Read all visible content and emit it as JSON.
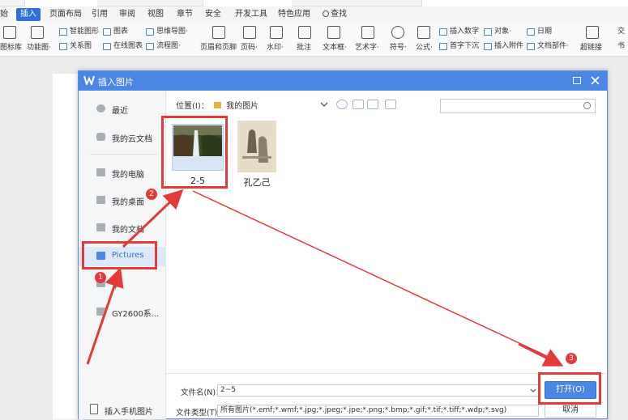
{
  "menu": {
    "tabs": [
      "始",
      "插入",
      "页面布局",
      "引用",
      "审阅",
      "视图",
      "章节",
      "安全",
      "开发工具",
      "特色应用",
      "查找"
    ],
    "active_index": 1
  },
  "ribbon": {
    "items": [
      "图标库",
      "功能图·",
      "智能图形",
      "关系图",
      "图表",
      "在线图表",
      "思维导图·",
      "流程图·",
      "页眉和页脚",
      "页码·",
      "水印·",
      "批注",
      "文本框·",
      "艺术字·",
      "符号·",
      "公式·",
      "插入数字",
      "首字下沉",
      "对象·",
      "插入附件",
      "日期",
      "文档部件·",
      "超链接",
      "交",
      "书"
    ]
  },
  "dialog": {
    "title": "插入图片",
    "location_label": "位置(I)：",
    "location_value": "我的图片",
    "sidebar": [
      {
        "label": "最近",
        "icon": "clock-icon"
      },
      {
        "label": "我的云文档",
        "icon": "cloud-icon"
      },
      {
        "label": "我的电脑",
        "icon": "computer-icon"
      },
      {
        "label": "我的桌面",
        "icon": "desktop-icon"
      },
      {
        "label": "我的文档",
        "icon": "folder-icon"
      },
      {
        "label": "Pictures",
        "icon": "folder-icon"
      },
      {
        "label": "乍",
        "icon": "folder-icon"
      },
      {
        "label": "GY2600系...",
        "icon": "folder-icon"
      }
    ],
    "phone_label": "插入手机图片",
    "files": [
      {
        "name": "2-5",
        "selected": true
      },
      {
        "name": "孔乙己",
        "selected": false
      }
    ],
    "filename_label": "文件名(N)：",
    "filename_value": "2~5",
    "filetype_label": "文件类型(T)：",
    "filetype_value": "所有图片(*.emf;*.wmf;*.jpg;*.jpeg;*.jpe;*.png;*.bmp;*.gif;*.tif;*.tiff;*.wdp;*.svg)",
    "open_button": "打开(O)",
    "cancel_button": "取消"
  },
  "annotations": {
    "steps": [
      "1",
      "2",
      "3"
    ],
    "color": "#e53a3a"
  }
}
